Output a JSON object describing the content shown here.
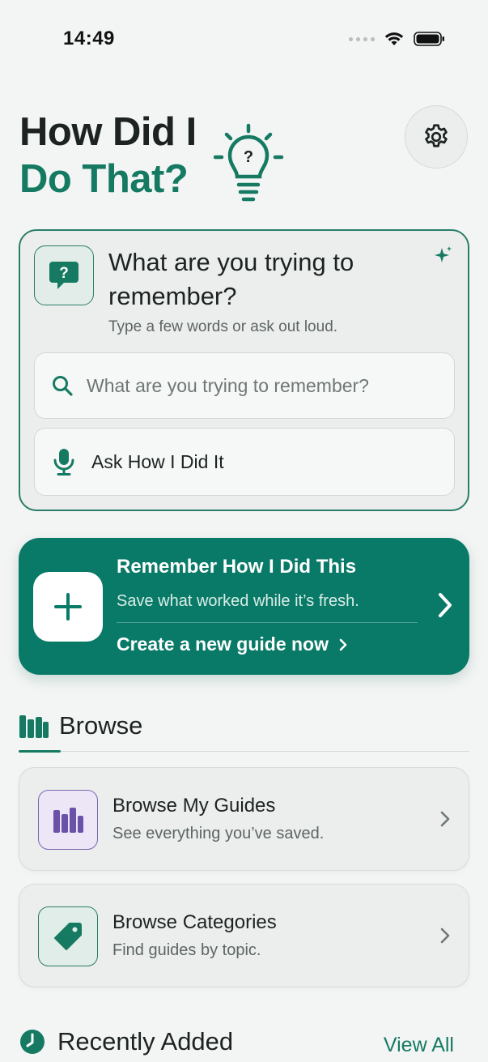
{
  "status_bar": {
    "time": "14:49"
  },
  "header": {
    "title_line1": "How Did I",
    "title_line2": "Do That?",
    "settings_icon": "gear-icon",
    "bulb_icon": "lightbulb-question-icon"
  },
  "ask_card": {
    "title": "What are you trying to remember?",
    "subtitle": "Type a few words or ask out loud.",
    "search_placeholder": "What are you trying to remember?",
    "voice_button_label": "Ask How I Did It"
  },
  "remember_card": {
    "title": "Remember How I Did This",
    "subtitle": "Save what worked while it’s fresh.",
    "link_label": "Create a new guide now"
  },
  "browse": {
    "section_title": "Browse",
    "items": [
      {
        "title": "Browse My Guides",
        "subtitle": "See everything you’ve saved.",
        "icon": "books-icon"
      },
      {
        "title": "Browse Categories",
        "subtitle": "Find guides by topic.",
        "icon": "tag-icon"
      }
    ]
  },
  "recent": {
    "section_title": "Recently Added",
    "view_all_label": "View All"
  },
  "colors": {
    "accent": "#167a63",
    "card_green": "#0a7a68",
    "background": "#f3f5f4",
    "purple": "#6a52a8"
  }
}
